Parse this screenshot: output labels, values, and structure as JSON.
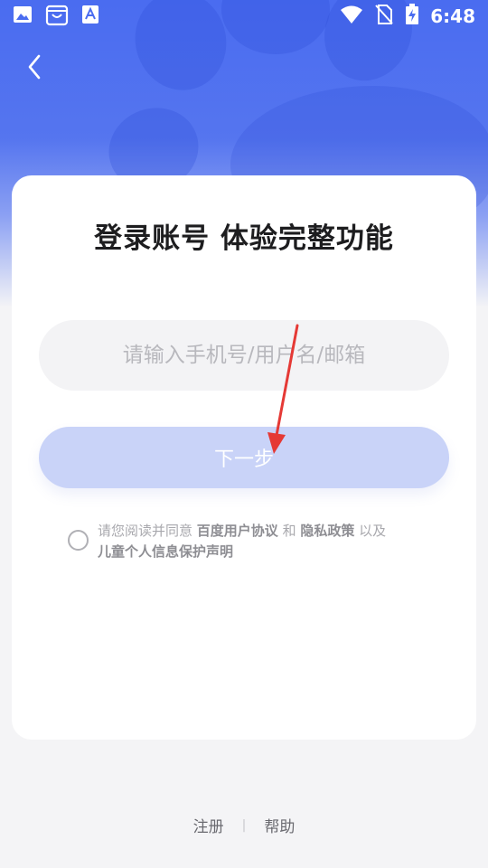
{
  "status_bar": {
    "time": "6:48",
    "left_icons": [
      "image-icon",
      "store-bag-icon",
      "font-icon"
    ],
    "right_icons": [
      "wifi-icon",
      "no-sim-icon",
      "battery-charging-icon"
    ]
  },
  "login": {
    "title": "登录账号 体验完整功能",
    "account_placeholder": "请输入手机号/用户名/邮箱",
    "account_value": "",
    "next_label": "下一步",
    "agreement": {
      "prefix": "请您阅读并同意 ",
      "link1": "百度用户协议",
      "and": " 和 ",
      "link2": "隐私政策",
      "also": " 以及",
      "link3": "儿童个人信息保护声明"
    }
  },
  "footer": {
    "register": "注册",
    "separator": "|",
    "help": "帮助"
  },
  "colors": {
    "accent": "#4a6cf0",
    "button_disabled": "#c9d3f8",
    "annotation_arrow": "#e53935"
  }
}
